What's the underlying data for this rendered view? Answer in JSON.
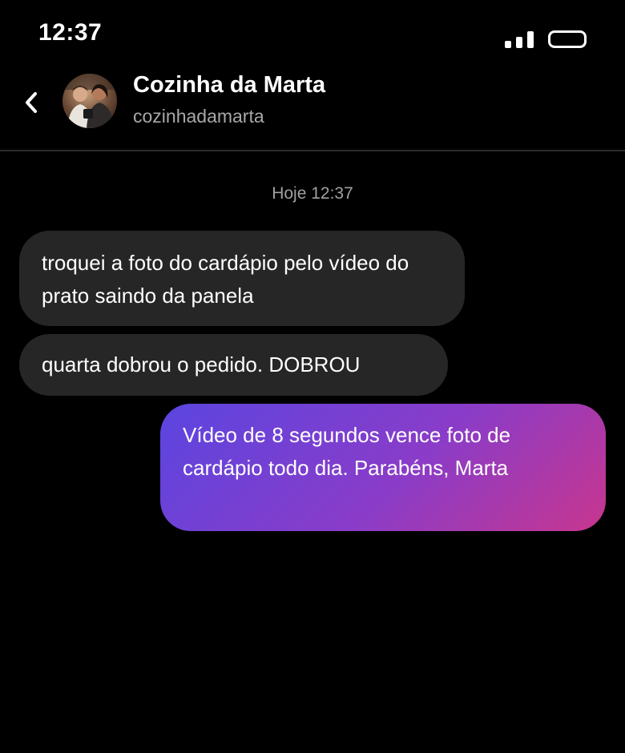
{
  "status_bar": {
    "time": "12:37"
  },
  "header": {
    "contact_name": "Cozinha da Marta",
    "contact_handle": "cozinhadamarta"
  },
  "conversation": {
    "timestamp": "Hoje 12:37",
    "messages": [
      {
        "direction": "incoming",
        "text": "troquei a foto do cardápio pelo vídeo do prato saindo da panela"
      },
      {
        "direction": "incoming",
        "text": "quarta dobrou o pedido. DOBROU"
      },
      {
        "direction": "outgoing",
        "text": "Vídeo de 8 segundos vence foto de cardápio todo dia. Parabéns, Marta"
      }
    ]
  },
  "colors": {
    "background": "#000000",
    "incoming_bubble": "#262626",
    "outgoing_gradient_start": "#5b45e0",
    "outgoing_gradient_end": "#c8368e",
    "secondary_text": "#a8a8a8"
  },
  "icons": {
    "back": "chevron-left-icon",
    "signal": "signal-icon",
    "battery": "battery-icon"
  }
}
